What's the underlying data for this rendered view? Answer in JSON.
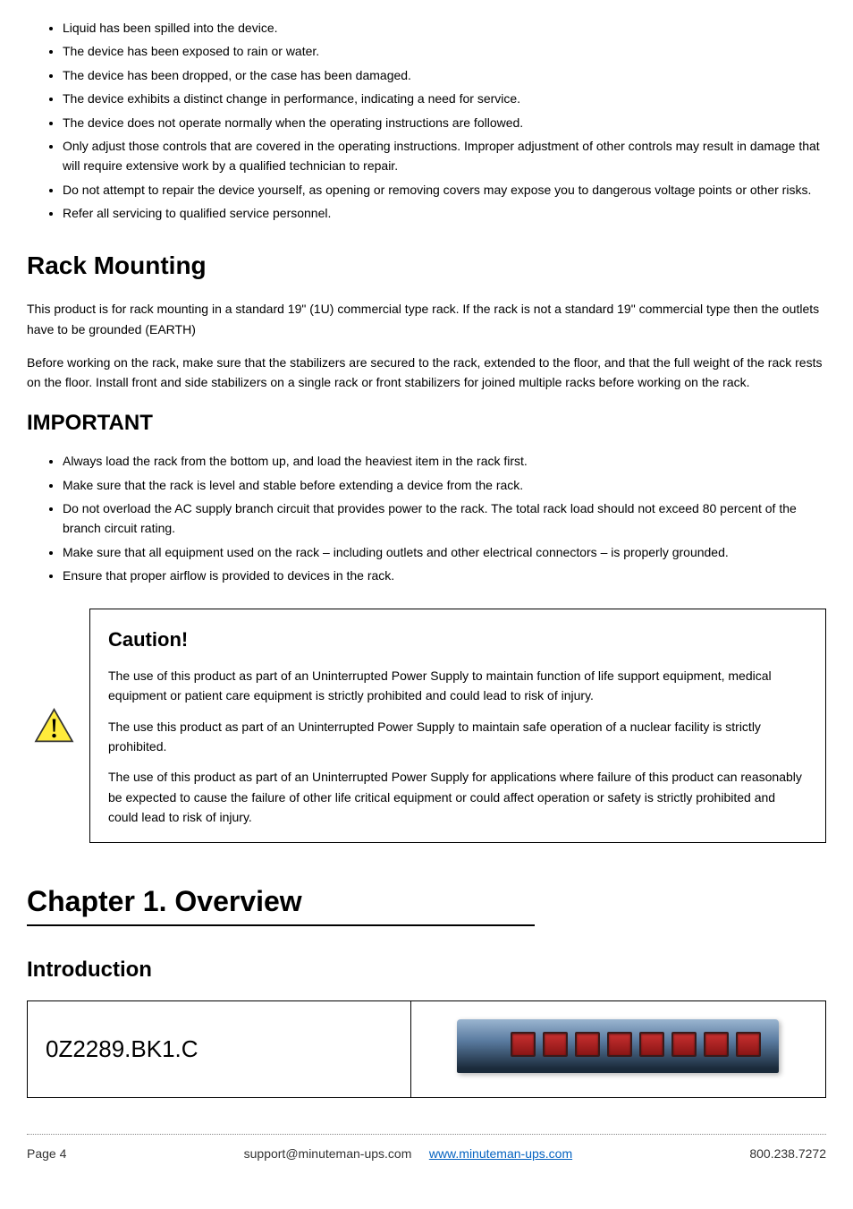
{
  "damageList": [
    "Liquid has been spilled into the device.",
    "The device has been exposed to rain or water.",
    "The device has been dropped, or the case has been damaged.",
    "The device exhibits a distinct change in performance, indicating a need for service.",
    "The device does not operate normally when the operating instructions are followed.",
    "Only adjust those controls that are covered in the operating instructions. Improper adjustment of other controls may result in damage that will require extensive work by a qualified technician to repair.",
    "Do not attempt to repair the device yourself, as opening or removing covers may expose you to dangerous voltage points or other risks.",
    "Refer all servicing to qualified service personnel."
  ],
  "sections": {
    "rackMounting": {
      "heading": "Rack Mounting",
      "para1": "This product is for rack mounting in a standard 19\" (1U) commercial type rack. If the rack is not a standard 19\" commercial type then the outlets have to be grounded (EARTH)",
      "para2": "Before working on the rack, make sure that the stabilizers are secured to the rack, extended to the floor, and that the full weight of the rack rests on the floor. Install front and side stabilizers on a single rack or front stabilizers for joined multiple racks before working on the rack."
    },
    "important": {
      "heading": "IMPORTANT",
      "items": [
        "Always load the rack from the bottom up, and load the heaviest item in the rack first.",
        "Make sure that the rack is level and stable before extending a device from the rack.",
        "Do not overload the AC supply branch circuit that provides power to the rack. The total rack load should not exceed 80 percent of the branch circuit rating.",
        "Make sure that all equipment used on the rack – including outlets and other electrical connectors – is properly grounded.",
        "Ensure that proper airflow is provided to devices in the rack."
      ]
    },
    "caution": {
      "heading": "Caution!",
      "para1": "The use of this product as part of an Uninterrupted Power Supply to maintain function of life support equipment, medical equipment or patient care equipment is strictly prohibited and could lead to risk of injury.",
      "para2": "The use this product as part of an Uninterrupted Power Supply to maintain safe operation of a nuclear facility is strictly prohibited.",
      "para3": "The use of this product as part of an Uninterrupted Power Supply for applications where failure of this product can reasonably be expected to cause the failure of other life critical equipment or could affect operation or safety is strictly prohibited and could lead to risk of injury."
    },
    "overview": {
      "heading": "Chapter 1. Overview"
    },
    "introduction": {
      "heading": "Introduction"
    },
    "product": {
      "name": "0Z2289.BK1.C"
    },
    "footer": {
      "left": "Page 4",
      "center": "support@minuteman-ups.com",
      "centerUrl": "www.minuteman-ups.com",
      "right": "800.238.7272"
    }
  }
}
